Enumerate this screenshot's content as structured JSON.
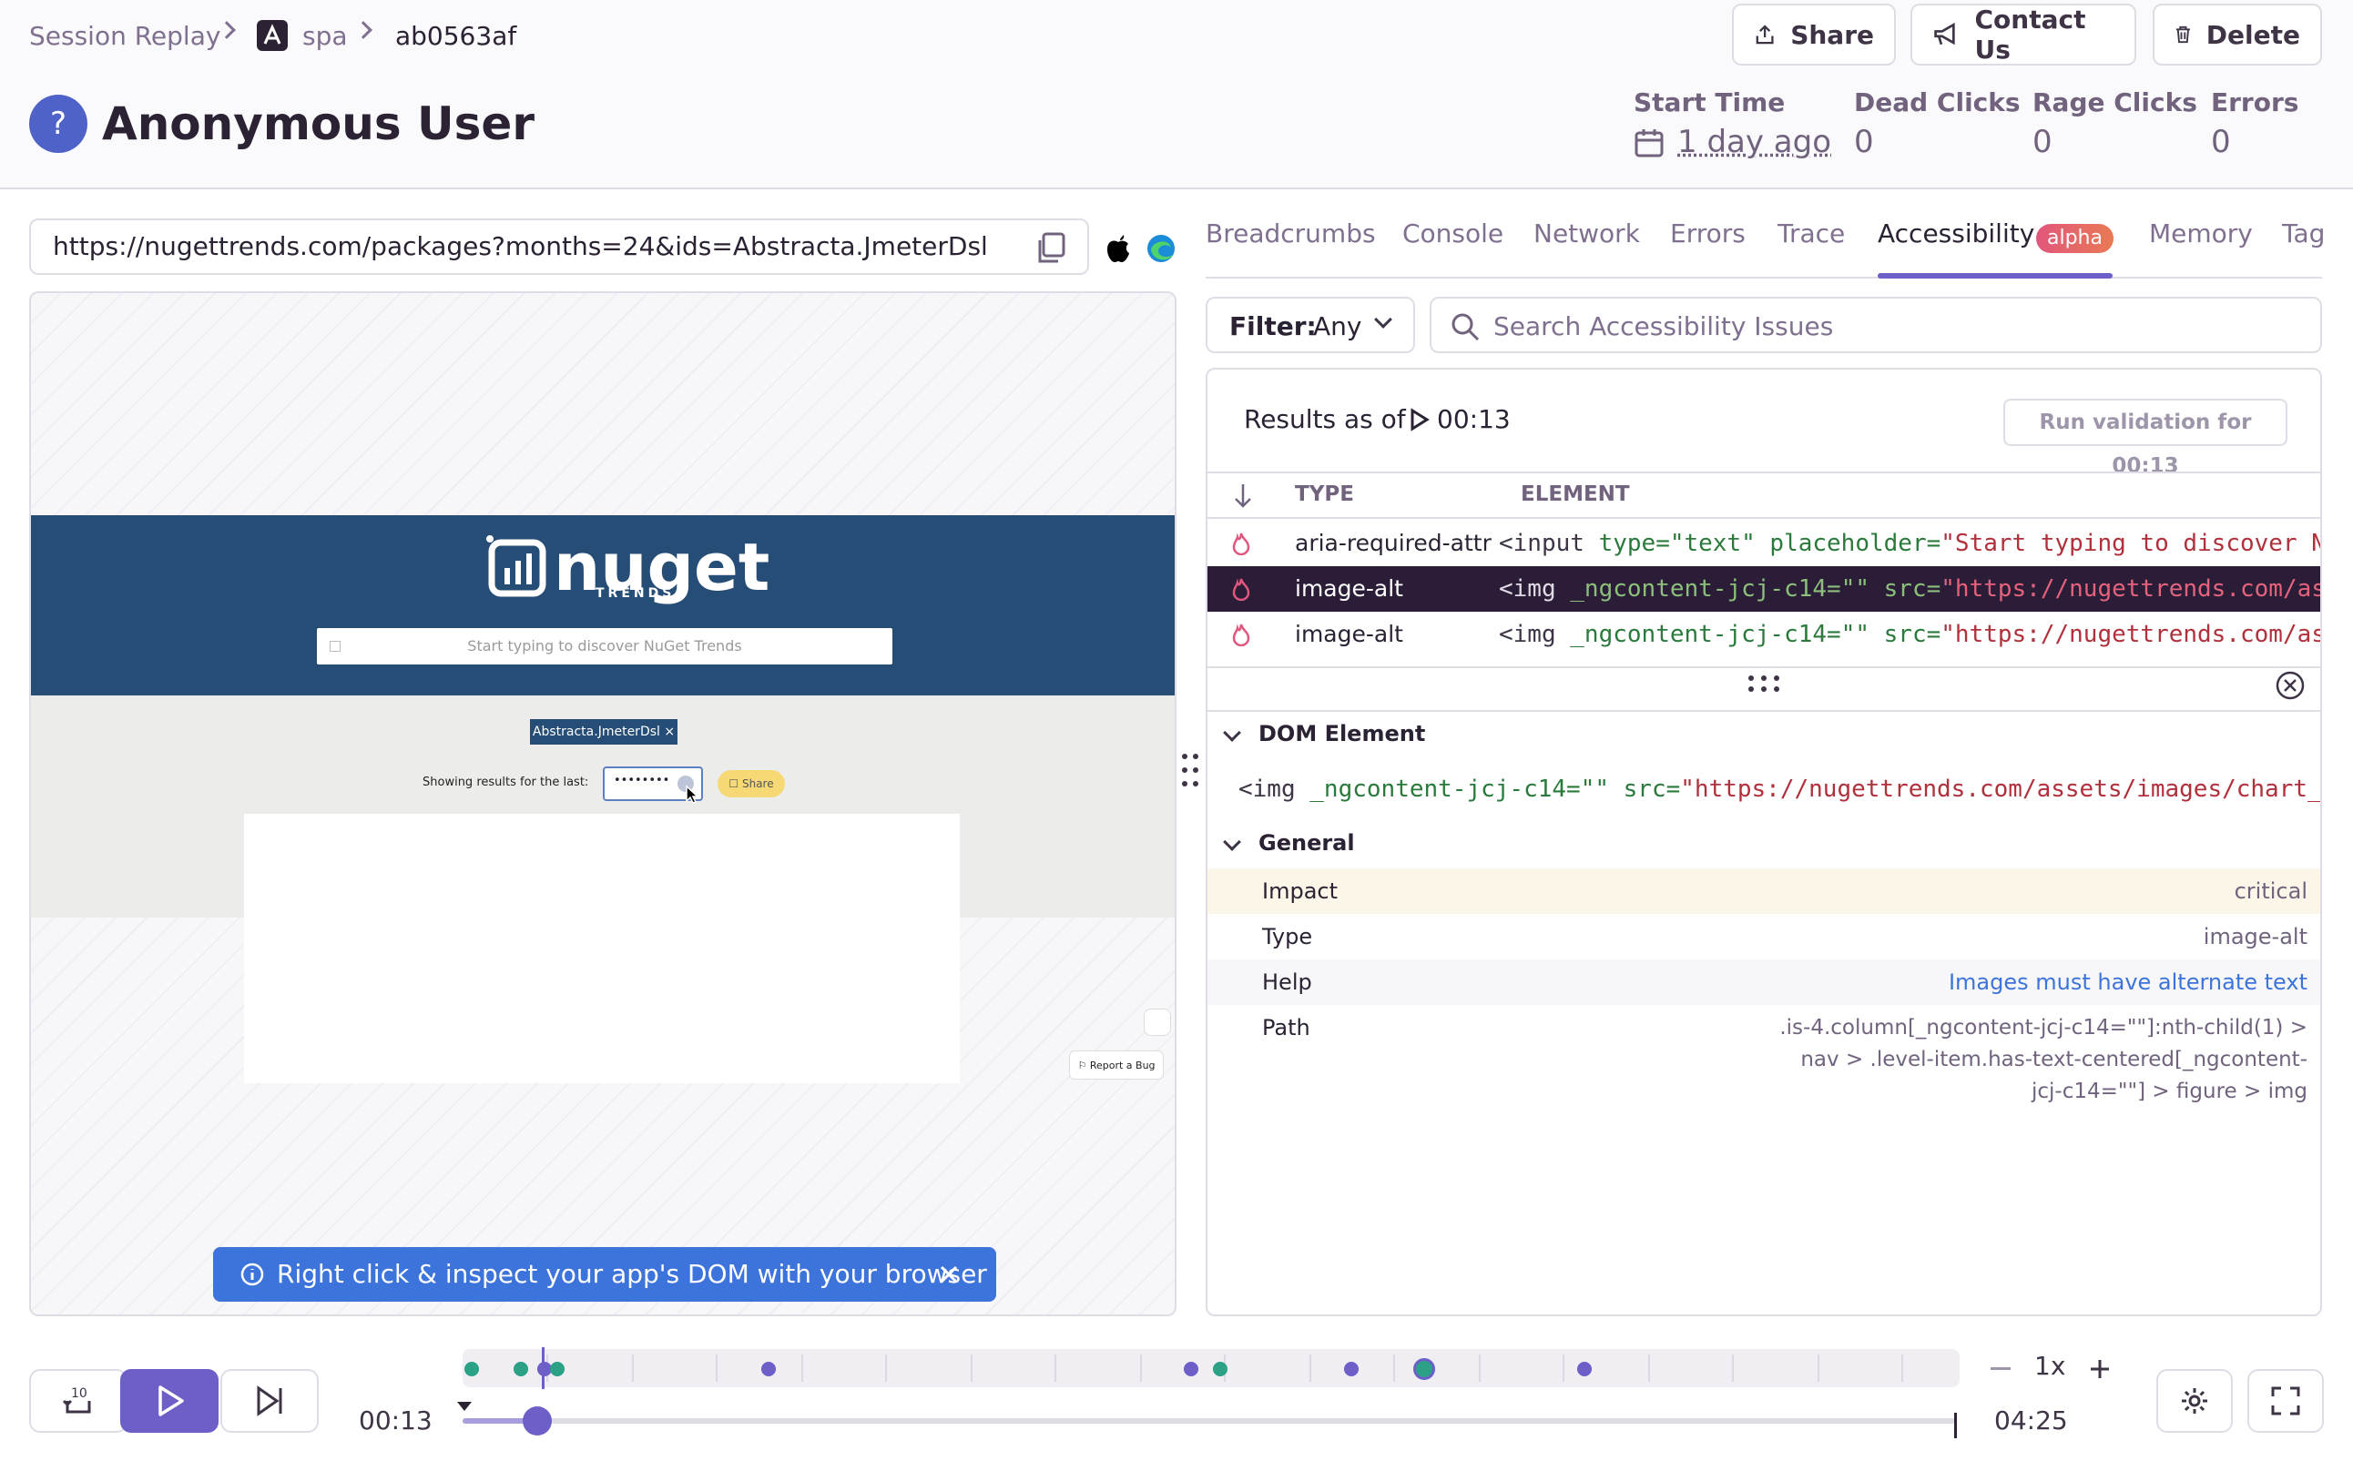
{
  "header": {
    "breadcrumbs": [
      "Session Replay",
      "spa",
      "ab0563af"
    ],
    "user_name": "Anonymous User",
    "user_avatar_glyph": "?",
    "actions": {
      "share": "Share",
      "contact": "Contact Us",
      "delete": "Delete"
    },
    "stats": {
      "start_time_label": "Start Time",
      "start_time_value": "1 day ago",
      "dead_clicks_label": "Dead Clicks",
      "dead_clicks_value": "0",
      "rage_clicks_label": "Rage Clicks",
      "rage_clicks_value": "0",
      "errors_label": "Errors",
      "errors_value": "0"
    }
  },
  "url_bar": {
    "url": "https://nugettrends.com/packages?months=24&ids=Abstracta.JmeterDsl"
  },
  "replay": {
    "site_logo_text": "nuget",
    "site_logo_subtext": "TRENDS",
    "search_placeholder": "Start typing to discover NuGet Trends",
    "package_tag": "Abstracta.JmeterDsl ×",
    "showing_label": "Showing results for the last:",
    "select_value": "••••••••",
    "share_label": "Share",
    "report_bug": "Report a Bug",
    "banner_text": "Right click & inspect your app's DOM with your browser"
  },
  "tabs": [
    {
      "label": "Breadcrumbs"
    },
    {
      "label": "Console"
    },
    {
      "label": "Network"
    },
    {
      "label": "Errors"
    },
    {
      "label": "Trace"
    },
    {
      "label": "Accessibility",
      "badge": "alpha"
    },
    {
      "label": "Memory"
    },
    {
      "label": "Tag"
    }
  ],
  "filter": {
    "label": "Filter:",
    "value": "Any"
  },
  "search": {
    "placeholder": "Search Accessibility Issues"
  },
  "results": {
    "results_as_of": "Results as of",
    "time": "00:13",
    "run_validation": "Run validation for 00:13",
    "col_type": "TYPE",
    "col_element": "ELEMENT",
    "rows": [
      {
        "type": "aria-required-attr",
        "el_tag": "<input",
        "el_attrs": " type=\"text\" placeholder=",
        "el_value": "\"Start typing to discover N"
      },
      {
        "type": "image-alt",
        "el_tag": "<img",
        "el_attrs": " _ngcontent-jcj-c14=\"\" src=",
        "el_value": "\"https://nugettrends.com/as"
      },
      {
        "type": "image-alt",
        "el_tag": "<img",
        "el_attrs": " _ngcontent-jcj-c14=\"\" src=",
        "el_value": "\"https://nugettrends.com/as"
      }
    ]
  },
  "details": {
    "dom_element_title": "DOM Element",
    "dom_tag": "<img",
    "dom_attrs": " _ngcontent-jcj-c14=\"\" src=",
    "dom_value": "\"https://nugettrends.com/assets/images/chart_i",
    "general_title": "General",
    "impact_label": "Impact",
    "impact_value": "critical",
    "type_label": "Type",
    "type_value": "image-alt",
    "help_label": "Help",
    "help_value": "Images must have alternate text",
    "path_label": "Path",
    "path_line1": ".is-4.column[_ngcontent-jcj-c14=\"\"]:nth-child(1) >",
    "path_line2": "nav > .level-item.has-text-centered[_ngcontent-",
    "path_line3": "jcj-c14=\"\"] > figure > img"
  },
  "timeline": {
    "current_time": "00:13",
    "total_time": "04:25",
    "speed": "1x",
    "progress_fraction": 0.05
  },
  "colors": {
    "accent": "#6c5fc7",
    "banner": "#3d74db",
    "nuget_blue": "#234a73",
    "danger": "#e1567c"
  }
}
